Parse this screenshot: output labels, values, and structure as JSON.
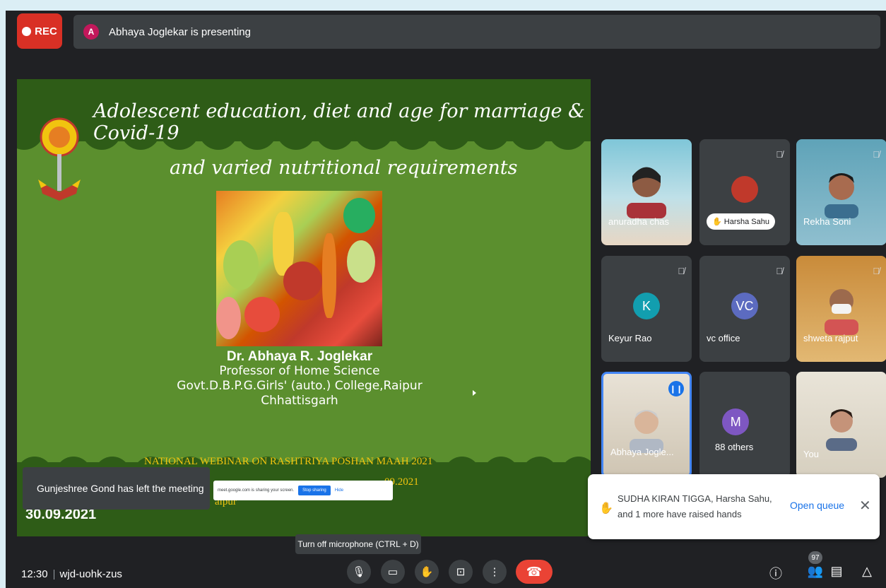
{
  "topbar": {
    "rec_label": "REC",
    "presenter_initial": "A",
    "presenting_text": "Abhaya Joglekar is presenting"
  },
  "slide": {
    "title_line1": "Adolescent education, diet and age for marriage & Covid-19",
    "title_line2": "and varied nutritional requirements",
    "presenter_name": "Dr. Abhaya R. Joglekar",
    "presenter_role": "Professor of Home Science",
    "presenter_college": "Govt.D.B.P.G.Girls' (auto.) College,Raipur",
    "presenter_state": "Chhattisgarh",
    "webinar_title": "NATIONAL WEBINAR ON RASHTRIYA POSHAN MAAH 2021",
    "webinar_line2": "09.2021",
    "webinar_line3": "aipur",
    "date": "30.09.2021"
  },
  "toast": {
    "text": "Gunjeshree Gond has left the meeting"
  },
  "share_bar": {
    "text": "meet.google.com is sharing your screen.",
    "stop_label": "Stop sharing",
    "hide_label": "Hide"
  },
  "participants": [
    {
      "name": "anuradha chas",
      "muted": false
    },
    {
      "name": "Harsha Sahu",
      "muted": true,
      "hand_raised": true
    },
    {
      "name": "Rekha Soni",
      "muted": true
    },
    {
      "name": "Keyur Rao",
      "muted": true,
      "initial": "K",
      "color": "#129eaf"
    },
    {
      "name": "vc office",
      "muted": true,
      "initial": "VC",
      "color": "#5c6bc0"
    },
    {
      "name": "shweta rajput",
      "muted": true
    },
    {
      "name": "Abhaya Jogle...",
      "muted": false,
      "speaking": true
    },
    {
      "name": "88 others",
      "initial": "M",
      "color": "#7e57c2"
    },
    {
      "name": "You"
    }
  ],
  "raised_hands": {
    "message": "SUDHA KIRAN TIGGA, Harsha Sahu, and 1 more have raised hands",
    "open_label": "Open queue",
    "close_label": "✕"
  },
  "tooltip": {
    "text": "Turn off microphone (CTRL + D)"
  },
  "footer": {
    "time": "12:30",
    "meeting_code": "wjd-uohk-zus",
    "people_count": "97"
  },
  "colors": {
    "rec": "#d93025",
    "end_call": "#ea4335",
    "accent": "#1a73e8",
    "slide_bg": "#5b8f2e"
  }
}
